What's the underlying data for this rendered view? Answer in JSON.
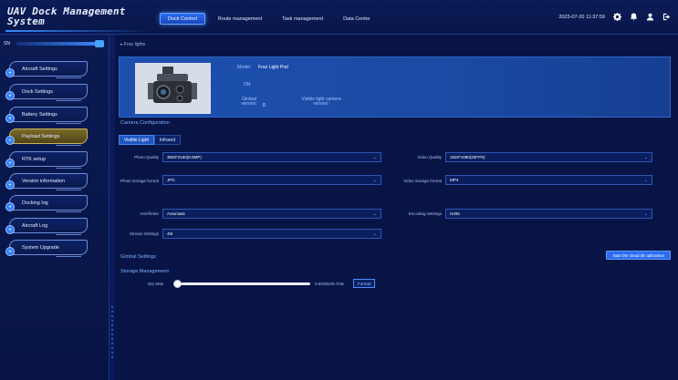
{
  "header": {
    "title": "UAV Dock Management System",
    "tabs": [
      "Dock Control",
      "Route management",
      "Task management",
      "Data Center"
    ],
    "active_tab": "Dock Control",
    "datetime": "2023-07-20 11:37:59",
    "icons": [
      "gear-icon",
      "bell-icon",
      "user-icon",
      "logout-icon"
    ]
  },
  "sidebar": {
    "top_label": "SN",
    "items": [
      {
        "label": "Aircraft Settings",
        "active": false
      },
      {
        "label": "Dock Settings",
        "active": false
      },
      {
        "label": "Battery Settings",
        "active": false
      },
      {
        "label": "Payload Settings",
        "active": true
      },
      {
        "label": "RTK setup",
        "active": false
      },
      {
        "label": "Version information",
        "active": false
      },
      {
        "label": "Docking log",
        "active": false
      },
      {
        "label": "Aircraft Log",
        "active": false
      },
      {
        "label": "System Upgrade",
        "active": false
      }
    ]
  },
  "main": {
    "breadcrumb": "Four lights",
    "info": {
      "model_label": "Model:",
      "model_value": "Four Light Pod",
      "status_value": "ON",
      "gimbal_label": "Gimbal version:",
      "gimbal_value": "0",
      "visible_label": "Visible light camera version:"
    },
    "camera_config_title": "Camera Configuration",
    "tabs": [
      "Visible Light",
      "Infrared"
    ],
    "active_tab": "Visible Light",
    "fields": {
      "photo_quality": {
        "label": "Photo Quality",
        "value": "3840*2160(8.0MP)"
      },
      "video_quality": {
        "label": "Video Quality",
        "value": "1920*1080(25FPS)"
      },
      "photo_storage": {
        "label": "Photo storage format",
        "value": "JPG"
      },
      "video_storage": {
        "label": "Video storage format",
        "value": "MP4"
      },
      "anti_flicker": {
        "label": "Anti-flicker",
        "value": "Automatic"
      },
      "encoding": {
        "label": "Encoding Settings",
        "value": "H265"
      },
      "stream": {
        "label": "Stream Settings",
        "value": "4M"
      }
    },
    "gimbal_settings_title": "Gimbal Settings",
    "start_button": "Start the cloud tilt calibration",
    "storage_title": "Storage Management",
    "storage": {
      "used": "811.5KB",
      "total": "9.80GB/29.7GB",
      "used_fraction": 0.02,
      "format_button": "Format"
    }
  }
}
